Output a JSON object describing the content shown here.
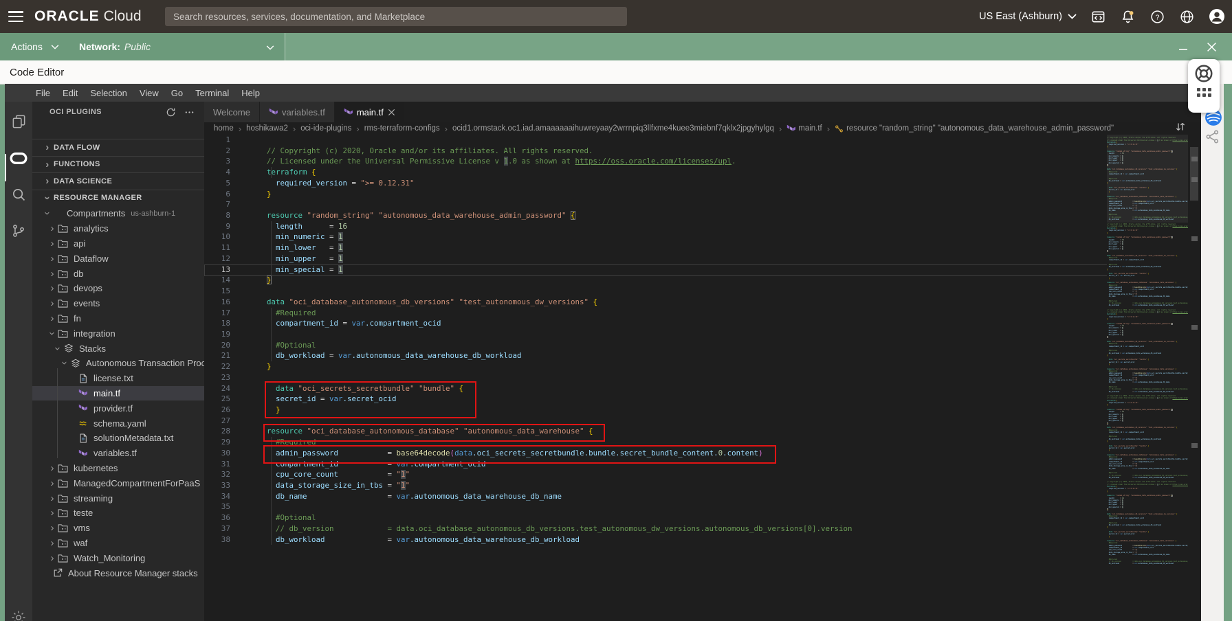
{
  "header": {
    "brand_primary": "ORACLE",
    "brand_secondary": "Cloud",
    "search_placeholder": "Search resources, services, documentation, and Marketplace",
    "region": "US East (Ashburn)",
    "icons": [
      "hamburger-icon",
      "code-editor-window-icon",
      "notifications-bell-icon",
      "help-icon",
      "language-globe-icon",
      "profile-avatar-icon"
    ]
  },
  "console_bar": {
    "actions_label": "Actions",
    "network_label": "Network:",
    "network_value": "Public",
    "window_icons": [
      "minimize-icon",
      "close-icon"
    ]
  },
  "window": {
    "title": "Code Editor"
  },
  "menu": {
    "items": [
      "File",
      "Edit",
      "Selection",
      "View",
      "Go",
      "Terminal",
      "Help"
    ]
  },
  "activity_bar": {
    "icons": [
      "files-icon",
      "oracle-plugins-icon",
      "search-icon",
      "source-control-icon",
      "gear-icon"
    ],
    "active": "oracle-plugins-icon"
  },
  "explorer": {
    "title": "OCI PLUGINS",
    "tools": [
      "refresh-icon",
      "more-actions-icon"
    ],
    "items": [
      {
        "type": "section",
        "label": "DATA FLOW",
        "chevron": "right"
      },
      {
        "type": "section",
        "label": "FUNCTIONS",
        "chevron": "right"
      },
      {
        "type": "section",
        "label": "DATA SCIENCE",
        "chevron": "right"
      },
      {
        "type": "section",
        "label": "RESOURCE MANAGER",
        "chevron": "down"
      },
      {
        "type": "comp",
        "label": "Compartments",
        "badge": "us-ashburn-1",
        "chevron": "down"
      },
      {
        "type": "folder",
        "label": "analytics",
        "chevron": "right",
        "icon": "folder"
      },
      {
        "type": "folder",
        "label": "api",
        "chevron": "right",
        "icon": "folder"
      },
      {
        "type": "folder",
        "label": "Dataflow",
        "chevron": "right",
        "icon": "folder"
      },
      {
        "type": "folder",
        "label": "db",
        "chevron": "right",
        "icon": "folder"
      },
      {
        "type": "folder",
        "label": "devops",
        "chevron": "right",
        "icon": "folder"
      },
      {
        "type": "folder",
        "label": "events",
        "chevron": "right",
        "icon": "folder"
      },
      {
        "type": "folder",
        "label": "fn",
        "chevron": "right",
        "icon": "folder"
      },
      {
        "type": "folder",
        "label": "integration",
        "chevron": "down",
        "icon": "folder"
      },
      {
        "type": "stack1",
        "label": "Stacks",
        "chevron": "down",
        "icon": "layers"
      },
      {
        "type": "stack2",
        "label": "Autonomous Transaction Proces...",
        "chevron": "down",
        "icon": "layers"
      },
      {
        "type": "file",
        "label": "license.txt",
        "icon": "file"
      },
      {
        "type": "file",
        "label": "main.tf",
        "icon": "tf",
        "selected": true
      },
      {
        "type": "file",
        "label": "provider.tf",
        "icon": "tf"
      },
      {
        "type": "file",
        "label": "schema.yaml",
        "icon": "yaml"
      },
      {
        "type": "file",
        "label": "solutionMetadata.txt",
        "icon": "file"
      },
      {
        "type": "file",
        "label": "variables.tf",
        "icon": "tf"
      },
      {
        "type": "folder",
        "label": "kubernetes",
        "chevron": "right",
        "icon": "folder"
      },
      {
        "type": "folder",
        "label": "ManagedCompartmentForPaaS",
        "chevron": "right",
        "icon": "folder"
      },
      {
        "type": "folder",
        "label": "streaming",
        "chevron": "right",
        "icon": "folder"
      },
      {
        "type": "folder",
        "label": "teste",
        "chevron": "right",
        "icon": "folder"
      },
      {
        "type": "folder",
        "label": "vms",
        "chevron": "right",
        "icon": "folder"
      },
      {
        "type": "folder",
        "label": "waf",
        "chevron": "right",
        "icon": "folder"
      },
      {
        "type": "folder",
        "label": "Watch_Monitoring",
        "chevron": "right",
        "icon": "folder"
      },
      {
        "type": "link",
        "label": "About Resource Manager stacks",
        "icon": "external"
      }
    ]
  },
  "tabs": [
    {
      "label": "Welcome",
      "active": false,
      "closable": false
    },
    {
      "label": "variables.tf",
      "icon": "tf",
      "active": false,
      "closable": false
    },
    {
      "label": "main.tf",
      "icon": "tf",
      "active": true,
      "closable": true
    }
  ],
  "breadcrumb": {
    "items": [
      {
        "label": "home"
      },
      {
        "label": "hoshikawa2"
      },
      {
        "label": "oci-ide-plugins"
      },
      {
        "label": "rms-terraform-configs"
      },
      {
        "label": "ocid1.ormstack.oc1.iad.amaaaaaaihuwreyaay2wrrnpiq3llfxme4kuee3miebnf7qklx2jpgyhylgq"
      },
      {
        "label": "main.tf",
        "icon": "tf"
      },
      {
        "label": "resource \"random_string\" \"autonomous_data_warehouse_admin_password\"",
        "icon": "symbol"
      }
    ]
  },
  "editor": {
    "active_line": 13,
    "lines": [
      {
        "n": 1,
        "t": []
      },
      {
        "n": 2,
        "t": [
          [
            "// Copyright (c) 2020, Oracle and/or its affiliates. All rights reserved.",
            "cm"
          ]
        ]
      },
      {
        "n": 3,
        "t": [
          [
            "// Licensed under the Universal Permissive License v ",
            "cm"
          ],
          [
            "1",
            "cm hl"
          ],
          [
            ".0 as shown at ",
            "cm"
          ],
          [
            "https://oss.oracle.com/licenses/upl",
            "cm lnk"
          ],
          [
            ".",
            "cm"
          ]
        ]
      },
      {
        "n": 4,
        "t": [
          [
            "terraform ",
            "kw"
          ],
          [
            "{",
            "b1"
          ]
        ]
      },
      {
        "n": 5,
        "t": [
          [
            "  required_version",
            "prop"
          ],
          [
            " = ",
            "pl"
          ],
          [
            "\">= 0.12.31\"",
            "str"
          ]
        ]
      },
      {
        "n": 6,
        "t": [
          [
            "}",
            "b1"
          ]
        ]
      },
      {
        "n": 7,
        "t": []
      },
      {
        "n": 8,
        "t": [
          [
            "resource ",
            "kw"
          ],
          [
            "\"random_string\" \"autonomous_data_warehouse_admin_password\" ",
            "str"
          ],
          [
            "{",
            "b1 bm"
          ]
        ]
      },
      {
        "n": 9,
        "t": [
          [
            "  length",
            "prop"
          ],
          [
            "      = ",
            "pl"
          ],
          [
            "16",
            "num"
          ]
        ]
      },
      {
        "n": 10,
        "t": [
          [
            "  min_numeric",
            "prop"
          ],
          [
            " = ",
            "pl"
          ],
          [
            "1",
            "num hl"
          ]
        ]
      },
      {
        "n": 11,
        "t": [
          [
            "  min_lower",
            "prop"
          ],
          [
            "   = ",
            "pl"
          ],
          [
            "1",
            "num hl"
          ]
        ]
      },
      {
        "n": 12,
        "t": [
          [
            "  min_upper",
            "prop"
          ],
          [
            "   = ",
            "pl"
          ],
          [
            "1",
            "num hl"
          ]
        ]
      },
      {
        "n": 13,
        "t": [
          [
            "  min_special",
            "prop"
          ],
          [
            " = ",
            "pl"
          ],
          [
            "1",
            "num hl"
          ]
        ]
      },
      {
        "n": 14,
        "t": [
          [
            "}",
            "b1 bm"
          ]
        ]
      },
      {
        "n": 15,
        "t": []
      },
      {
        "n": 16,
        "t": [
          [
            "data ",
            "kw"
          ],
          [
            "\"oci_database_autonomous_db_versions\" \"test_autonomous_dw_versions\" ",
            "str"
          ],
          [
            "{",
            "b1"
          ]
        ]
      },
      {
        "n": 17,
        "t": [
          [
            "  #Required",
            "cm"
          ]
        ]
      },
      {
        "n": 18,
        "t": [
          [
            "  compartment_id",
            "prop"
          ],
          [
            " = ",
            "pl"
          ],
          [
            "var",
            "vkw"
          ],
          [
            ".compartment_ocid",
            "prop"
          ]
        ]
      },
      {
        "n": 19,
        "t": []
      },
      {
        "n": 20,
        "t": [
          [
            "  #Optional",
            "cm"
          ]
        ]
      },
      {
        "n": 21,
        "t": [
          [
            "  db_workload",
            "prop"
          ],
          [
            " = ",
            "pl"
          ],
          [
            "var",
            "vkw"
          ],
          [
            ".autonomous_data_warehouse_db_workload",
            "prop"
          ]
        ]
      },
      {
        "n": 22,
        "t": [
          [
            "}",
            "b1"
          ]
        ]
      },
      {
        "n": 23,
        "t": []
      },
      {
        "n": 24,
        "t": [
          [
            "  data ",
            "kw"
          ],
          [
            "\"oci_secrets_secretbundle\" \"bundle\" ",
            "str"
          ],
          [
            "{",
            "b1"
          ]
        ]
      },
      {
        "n": 25,
        "t": [
          [
            "  secret_id",
            "prop"
          ],
          [
            " = ",
            "pl"
          ],
          [
            "var",
            "vkw"
          ],
          [
            ".secret_ocid",
            "prop"
          ]
        ]
      },
      {
        "n": 26,
        "t": [
          [
            "  }",
            "b1"
          ]
        ]
      },
      {
        "n": 27,
        "t": []
      },
      {
        "n": 28,
        "t": [
          [
            "resource ",
            "kw"
          ],
          [
            "\"oci_database_autonomous_database\" \"autonomous_data_warehouse\" ",
            "str"
          ],
          [
            "{",
            "b1"
          ]
        ]
      },
      {
        "n": 29,
        "t": [
          [
            "  #Required",
            "cm"
          ]
        ]
      },
      {
        "n": 30,
        "t": [
          [
            "  admin_password",
            "prop"
          ],
          [
            "           = ",
            "pl"
          ],
          [
            "base64decode",
            "fn"
          ],
          [
            "(",
            "b2"
          ],
          [
            "data",
            "vkw"
          ],
          [
            ".oci_secrets_secretbundle.bundle.secret_bundle_content.",
            "prop"
          ],
          [
            "0",
            "num"
          ],
          [
            ".content",
            "prop"
          ],
          [
            ")",
            "b2"
          ]
        ]
      },
      {
        "n": 31,
        "t": [
          [
            "  compartment_id",
            "prop"
          ],
          [
            "           = ",
            "pl"
          ],
          [
            "var",
            "vkw"
          ],
          [
            ".compartment_ocid",
            "prop"
          ]
        ]
      },
      {
        "n": 32,
        "t": [
          [
            "  cpu_core_count",
            "prop"
          ],
          [
            "           = ",
            "pl"
          ],
          [
            "\"",
            "str"
          ],
          [
            "1",
            "str hl"
          ],
          [
            "\"",
            "str"
          ]
        ]
      },
      {
        "n": 33,
        "t": [
          [
            "  data_storage_size_in_tbs",
            "prop"
          ],
          [
            " = ",
            "pl"
          ],
          [
            "\"",
            "str"
          ],
          [
            "1",
            "str hl"
          ],
          [
            "\"",
            "str"
          ]
        ]
      },
      {
        "n": 34,
        "t": [
          [
            "  db_name",
            "prop"
          ],
          [
            "                  = ",
            "pl"
          ],
          [
            "var",
            "vkw"
          ],
          [
            ".autonomous_data_warehouse_db_name",
            "prop"
          ]
        ]
      },
      {
        "n": 35,
        "t": []
      },
      {
        "n": 36,
        "t": [
          [
            "  #Optional",
            "cm"
          ]
        ]
      },
      {
        "n": 37,
        "t": [
          [
            "  // db_version            = data.oci_database_autonomous_db_versions.test_autonomous_dw_versions.autonomous_db_versions[0].version",
            "cm"
          ]
        ]
      },
      {
        "n": 38,
        "t": [
          [
            "  db_workload",
            "prop"
          ],
          [
            "              = ",
            "pl"
          ],
          [
            "var",
            "vkw"
          ],
          [
            ".autonomous_data_warehouse_db_workload",
            "prop"
          ]
        ]
      }
    ]
  },
  "colors": {
    "console_green": "#78a486",
    "header_dark": "#38332e",
    "editor_bg": "#1e1e1e",
    "annotation_red": "#e11414",
    "terraform_purple": "#9068c9"
  }
}
